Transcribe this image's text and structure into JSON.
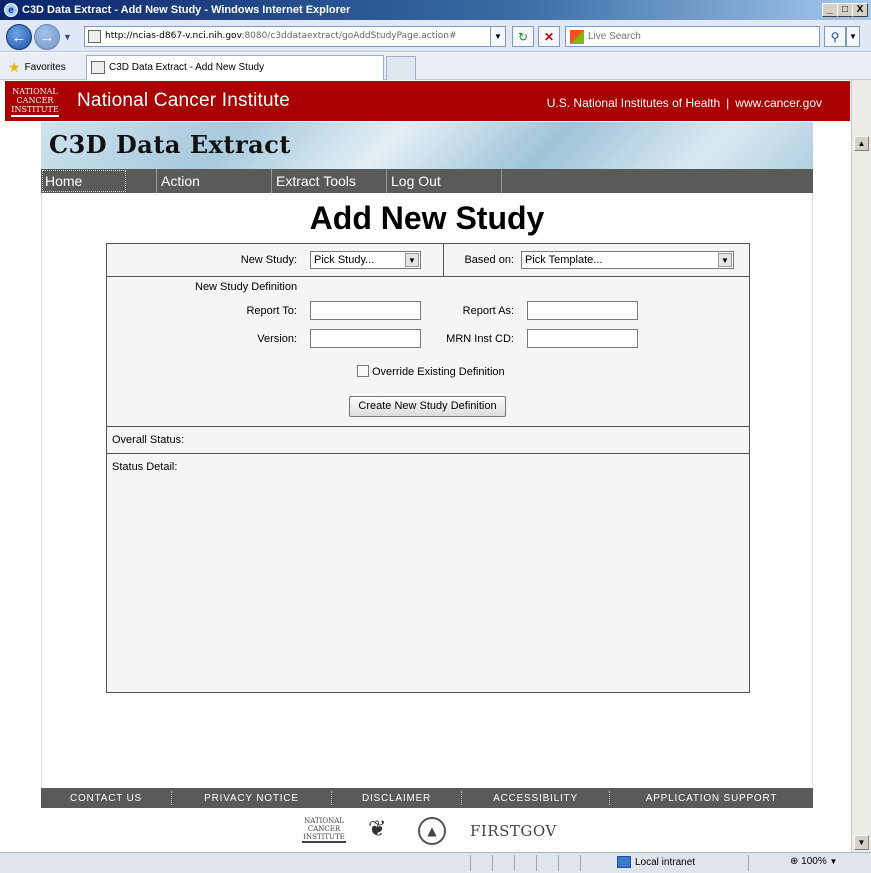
{
  "window": {
    "title": "C3D Data Extract - Add New Study - Windows Internet Explorer",
    "controls": [
      "_",
      "□",
      "X"
    ]
  },
  "browser": {
    "url_host": "http://ncias-d867-v.nci.nih.gov",
    "url_rest": ":8080/c3ddataextract/goAddStudyPage.action#",
    "search_placeholder": "Live Search",
    "favorites_label": "Favorites",
    "tab_title": "C3D Data Extract - Add New Study",
    "status_zone": "Local intranet",
    "zoom": "100%"
  },
  "nci_banner": {
    "logo_text": "NATIONAL CANCER INSTITUTE",
    "title": "National Cancer Institute",
    "link_nih": "U.S. National Institutes of Health",
    "separator": "|",
    "link_cancer": "www.cancer.gov"
  },
  "app": {
    "title": "C3D Data Extract",
    "menu": [
      "Home",
      "Action",
      "Extract Tools",
      "Log Out"
    ]
  },
  "page": {
    "title": "Add New Study"
  },
  "form": {
    "new_study_label": "New Study:",
    "new_study_value": "Pick Study...",
    "based_on_label": "Based on:",
    "based_on_value": "Pick Template...",
    "definition_heading": "New Study Definition",
    "report_to_label": "Report To:",
    "report_as_label": "Report As:",
    "version_label": "Version:",
    "mrn_label": "MRN Inst CD:",
    "override_label": "Override Existing Definition",
    "override_checked": false,
    "create_button": "Create New Study Definition",
    "overall_status_label": "Overall Status:",
    "status_detail_label": "Status Detail:"
  },
  "footer": {
    "links": [
      "CONTACT US",
      "PRIVACY NOTICE",
      "DISCLAIMER",
      "ACCESSIBILITY",
      "APPLICATION SUPPORT"
    ],
    "logos": [
      "NATIONAL CANCER INSTITUTE",
      "FIRSTGOV"
    ]
  }
}
